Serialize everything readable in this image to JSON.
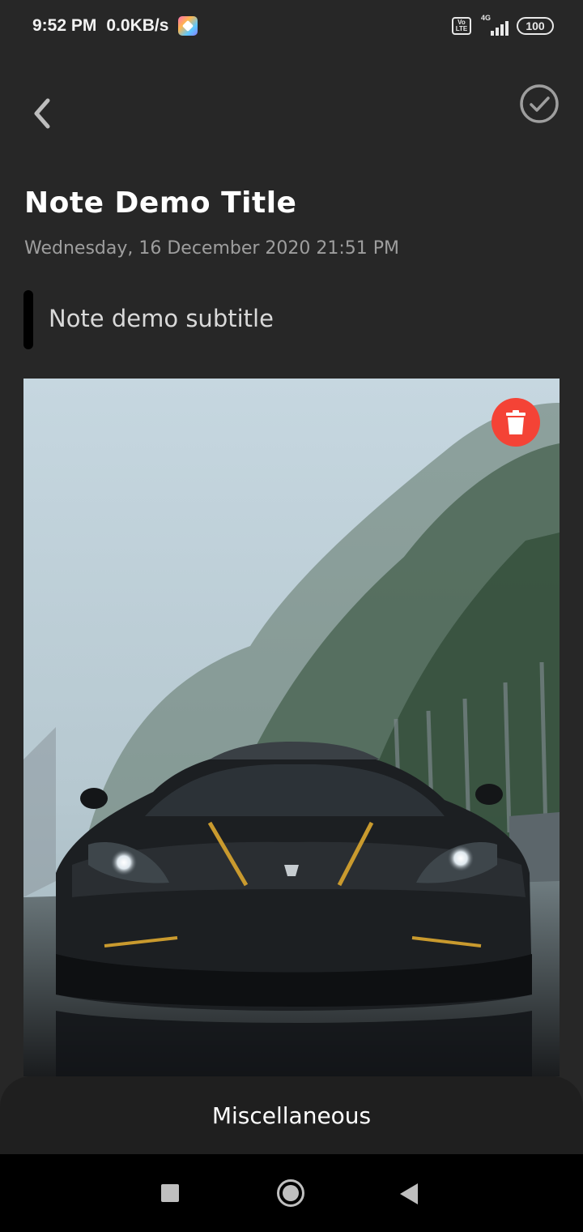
{
  "status_bar": {
    "time": "9:52 PM",
    "speed": "0.0KB/s",
    "volte": "Vo LTE",
    "network": "4G",
    "battery": "100"
  },
  "toolbar": {
    "back_icon": "chevron-left-icon",
    "done_icon": "check-circle-icon"
  },
  "note": {
    "title": "Note Demo Title",
    "date": "Wednesday, 16 December 2020 21:51 PM",
    "subtitle": "Note demo subtitle",
    "image_alt": "Black sports car on a wet road",
    "delete_icon": "trash-icon"
  },
  "bottom_sheet": {
    "label": "Miscellaneous"
  },
  "nav_bar": {
    "recent_icon": "square-icon",
    "home_icon": "circle-icon",
    "back_icon": "triangle-back-icon"
  },
  "colors": {
    "background": "#272727",
    "sheet": "#1f1f1f",
    "delete": "#f44336",
    "date_text": "#9e9e9e"
  }
}
